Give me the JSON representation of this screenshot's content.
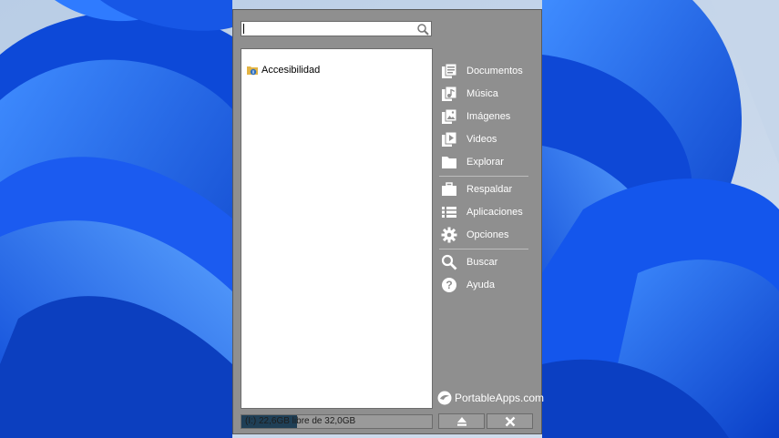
{
  "search": {
    "value": "",
    "placeholder": "",
    "icon": "search-icon"
  },
  "app_list": {
    "items": [
      {
        "label": "Accesibilidad",
        "icon": "folder-icon"
      }
    ]
  },
  "side_menu": {
    "items": [
      {
        "label": "Documentos",
        "icon": "documents-icon"
      },
      {
        "label": "Música",
        "icon": "music-icon"
      },
      {
        "label": "Imágenes",
        "icon": "images-icon"
      },
      {
        "label": "Videos",
        "icon": "videos-icon"
      },
      {
        "label": "Explorar",
        "icon": "folder-icon"
      },
      {
        "label": "Respaldar",
        "icon": "briefcase-icon"
      },
      {
        "label": "Aplicaciones",
        "icon": "list-icon"
      },
      {
        "label": "Opciones",
        "icon": "gear-icon"
      },
      {
        "label": "Buscar",
        "icon": "search-icon"
      },
      {
        "label": "Ayuda",
        "icon": "help-icon"
      }
    ]
  },
  "brand": {
    "label": "PortableApps.com"
  },
  "drive": {
    "text": "(I:) 22,6GB libre de 32,0GB",
    "used_fraction": 0.29
  },
  "buttons": {
    "eject_icon": "eject-icon",
    "close_icon": "close-icon"
  },
  "colors": {
    "panel": "#8f8f8f",
    "drive_fill": "#1f3f56",
    "wallpaper_blue": "#1560e8"
  }
}
